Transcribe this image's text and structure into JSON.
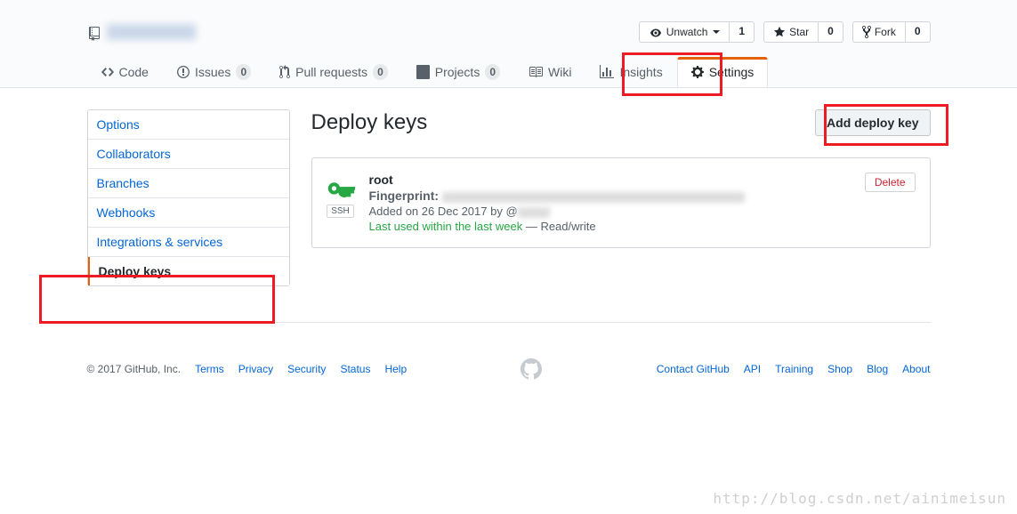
{
  "header": {
    "actions": {
      "unwatch": {
        "label": "Unwatch",
        "count": "1"
      },
      "star": {
        "label": "Star",
        "count": "0"
      },
      "fork": {
        "label": "Fork",
        "count": "0"
      }
    }
  },
  "nav": {
    "code": "Code",
    "issues": {
      "label": "Issues",
      "count": "0"
    },
    "pulls": {
      "label": "Pull requests",
      "count": "0"
    },
    "projects": {
      "label": "Projects",
      "count": "0"
    },
    "wiki": "Wiki",
    "insights": "Insights",
    "settings": "Settings"
  },
  "sidebar": {
    "items": [
      {
        "label": "Options"
      },
      {
        "label": "Collaborators"
      },
      {
        "label": "Branches"
      },
      {
        "label": "Webhooks"
      },
      {
        "label": "Integrations & services"
      },
      {
        "label": "Deploy keys"
      }
    ]
  },
  "main": {
    "title": "Deploy keys",
    "add_button": "Add deploy key",
    "key": {
      "name": "root",
      "type_label": "SSH",
      "fingerprint_label": "Fingerprint:",
      "added": "Added on 26 Dec 2017 by @",
      "last_used": "Last used within the last week",
      "access": " — Read/write",
      "delete": "Delete"
    }
  },
  "footer": {
    "copyright": "© 2017 GitHub, Inc.",
    "left_links": [
      "Terms",
      "Privacy",
      "Security",
      "Status",
      "Help"
    ],
    "right_links": [
      "Contact GitHub",
      "API",
      "Training",
      "Shop",
      "Blog",
      "About"
    ]
  },
  "watermark": "http://blog.csdn.net/ainimeisun"
}
